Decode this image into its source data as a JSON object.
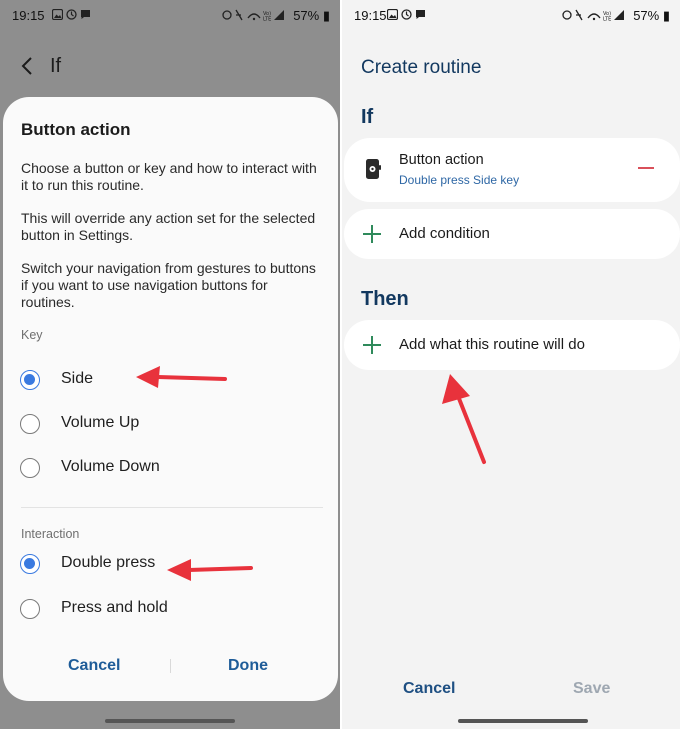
{
  "status_bar": {
    "time": "19:15",
    "battery": "57%"
  },
  "left": {
    "header_title": "If",
    "sheet": {
      "title": "Button action",
      "paragraphs": [
        "Choose a button or key and how to interact with it to run this routine.",
        "This will override any action set for the selected button in Settings.",
        "Switch your navigation from gestures to buttons if you want to use navigation buttons for routines."
      ],
      "key_label": "Key",
      "key_options": [
        {
          "label": "Side",
          "selected": true
        },
        {
          "label": "Volume Up",
          "selected": false
        },
        {
          "label": "Volume Down",
          "selected": false
        }
      ],
      "interaction_label": "Interaction",
      "interaction_options": [
        {
          "label": "Double press",
          "selected": true
        },
        {
          "label": "Press and hold",
          "selected": false
        }
      ],
      "cancel": "Cancel",
      "done": "Done"
    }
  },
  "right": {
    "title": "Create routine",
    "if_label": "If",
    "condition": {
      "title": "Button action",
      "subtitle": "Double press Side key"
    },
    "add_condition": "Add condition",
    "then_label": "Then",
    "add_action": "Add what this routine will do",
    "cancel": "Cancel",
    "save": "Save"
  },
  "colors": {
    "accent_blue": "#3a7ae0",
    "annotation_arrow": "#e8323c",
    "plus_green": "#2f8a5b",
    "remove_red": "#d9505a"
  }
}
